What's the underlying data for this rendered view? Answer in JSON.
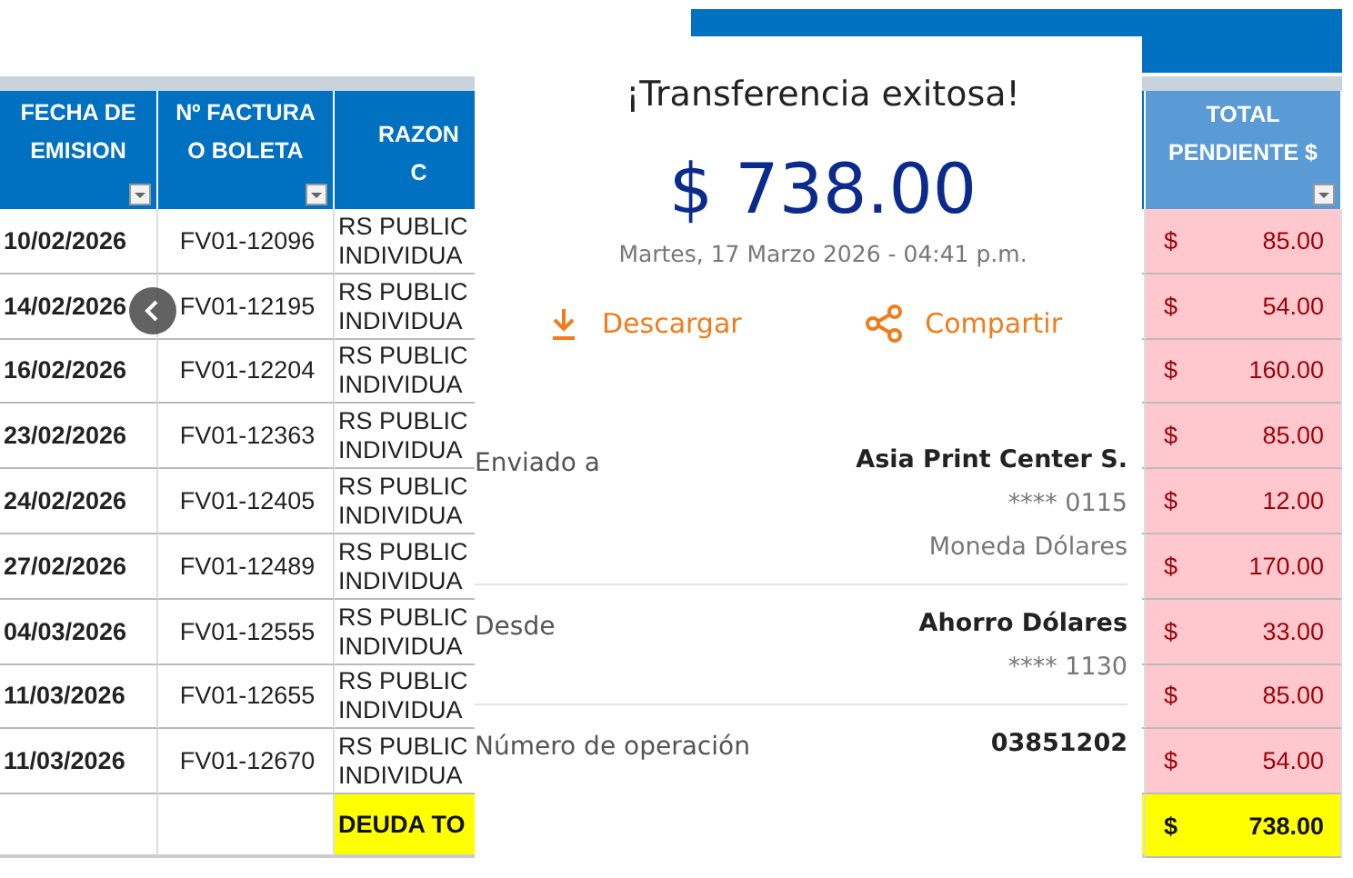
{
  "spreadsheet": {
    "columns": [
      {
        "label": [
          "FECHA DE",
          "EMISION"
        ]
      },
      {
        "label": [
          "Nº FACTURA",
          "O BOLETA"
        ]
      },
      {
        "label": [
          "RAZON",
          "C"
        ]
      },
      {
        "label": [
          "TOTAL",
          "PENDIENTE $"
        ]
      }
    ],
    "rows": [
      {
        "date": "10/02/2026",
        "invoice": "FV01-12096",
        "name": [
          "RS PUBLIC",
          "INDIVIDUA"
        ],
        "currency": "$",
        "amount": "85.00"
      },
      {
        "date": "14/02/2026",
        "invoice": "FV01-12195",
        "name": [
          "RS PUBLIC",
          "INDIVIDUA"
        ],
        "currency": "$",
        "amount": "54.00"
      },
      {
        "date": "16/02/2026",
        "invoice": "FV01-12204",
        "name": [
          "RS PUBLIC",
          "INDIVIDUA"
        ],
        "currency": "$",
        "amount": "160.00"
      },
      {
        "date": "23/02/2026",
        "invoice": "FV01-12363",
        "name": [
          "RS PUBLIC",
          "INDIVIDUA"
        ],
        "currency": "$",
        "amount": "85.00"
      },
      {
        "date": "24/02/2026",
        "invoice": "FV01-12405",
        "name": [
          "RS PUBLIC",
          "INDIVIDUA"
        ],
        "currency": "$",
        "amount": "12.00"
      },
      {
        "date": "27/02/2026",
        "invoice": "FV01-12489",
        "name": [
          "RS PUBLIC",
          "INDIVIDUA"
        ],
        "currency": "$",
        "amount": "170.00"
      },
      {
        "date": "04/03/2026",
        "invoice": "FV01-12555",
        "name": [
          "RS PUBLIC",
          "INDIVIDUA"
        ],
        "currency": "$",
        "amount": "33.00"
      },
      {
        "date": "11/03/2026",
        "invoice": "FV01-12655",
        "name": [
          "RS PUBLIC",
          "INDIVIDUA"
        ],
        "currency": "$",
        "amount": "85.00"
      },
      {
        "date": "11/03/2026",
        "invoice": "FV01-12670",
        "name": [
          "RS PUBLIC",
          "INDIVIDUA"
        ],
        "currency": "$",
        "amount": "54.00"
      }
    ],
    "total": {
      "label": "DEUDA TO",
      "currency": "$",
      "amount": "738.00"
    }
  },
  "receipt": {
    "title": "¡Transferencia exitosa!",
    "amount": "$ 738.00",
    "datetime": "Martes, 17 Marzo 2026 - 04:41 p.m.",
    "actions": [
      {
        "kind": "download",
        "label": "Descargar"
      },
      {
        "kind": "share",
        "label": "Compartir"
      }
    ],
    "details": [
      {
        "label": "Enviado a",
        "values": [
          {
            "text": "Asia Print Center S.",
            "bold": true
          },
          {
            "text": "**** 0115",
            "bold": false
          },
          {
            "text": "Moneda Dólares",
            "bold": false
          }
        ]
      },
      {
        "label": "Desde",
        "values": [
          {
            "text": "Ahorro Dólares",
            "bold": true
          },
          {
            "text": "**** 1130",
            "bold": false
          }
        ]
      },
      {
        "label": "Número de operación",
        "values": [
          {
            "text": "03851202",
            "bold": true
          }
        ]
      }
    ]
  }
}
